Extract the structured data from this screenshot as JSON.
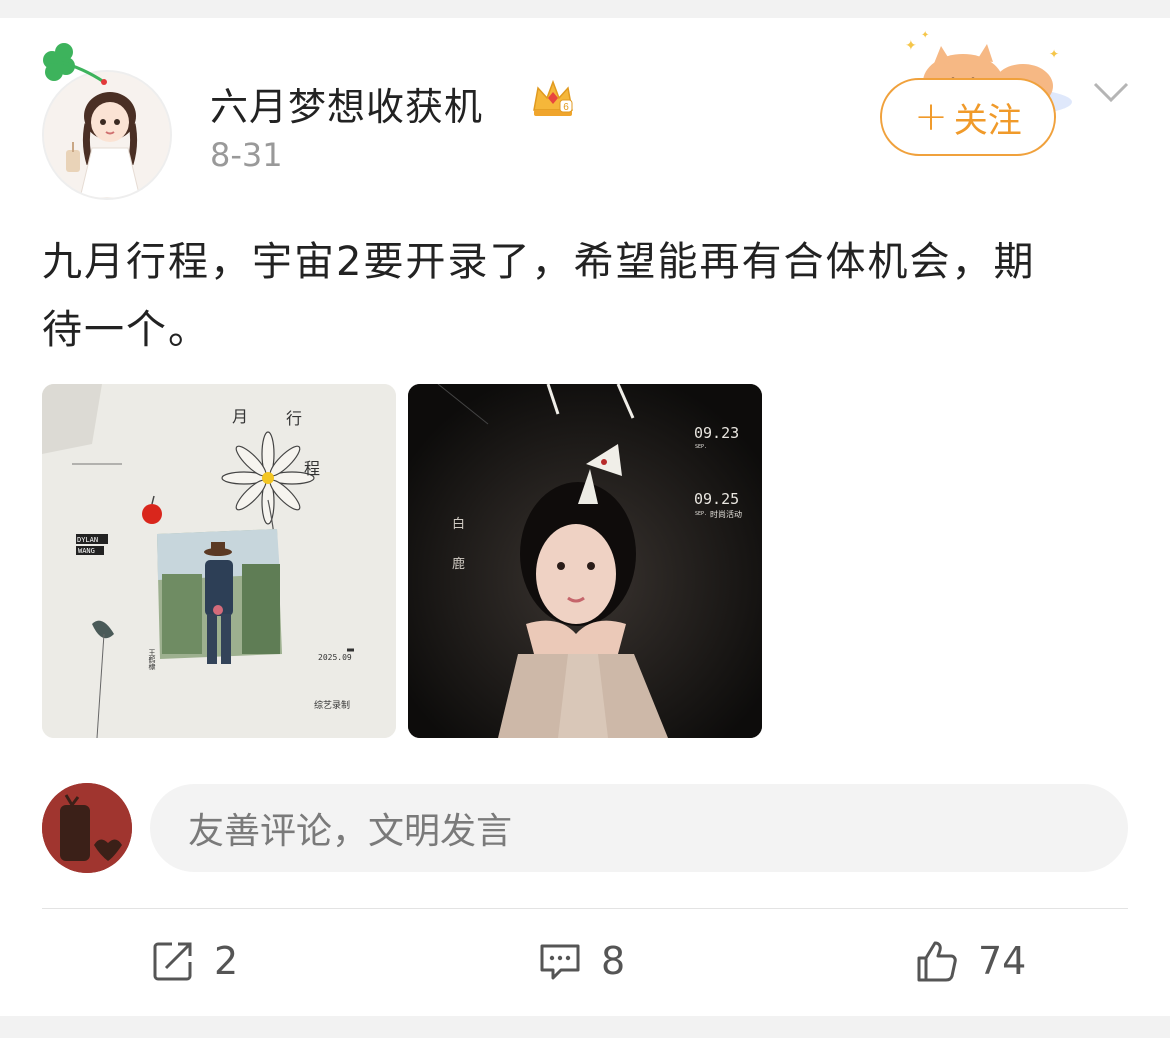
{
  "post": {
    "username": "六月梦想收获机",
    "date": "8-31",
    "follow_label": "关注",
    "text": "九月行程，宇宙2要开录了，希望能再有合体机会，期待一个。"
  },
  "images": [
    {
      "labels": {
        "title_1": "月",
        "title_2": "行",
        "title_3": "程",
        "brand_1": "DYLAN",
        "brand_2": "WANG",
        "name": "王鹤棣",
        "date": "2025.09",
        "caption": "综艺录制"
      }
    },
    {
      "labels": {
        "date_1": "09.23",
        "sep_1": "SEP.",
        "date_2": "09.25",
        "sep_2": "SEP.",
        "event": "时尚活动",
        "name_1": "白",
        "name_2": "鹿"
      }
    }
  ],
  "comment": {
    "placeholder": "友善评论，文明发言"
  },
  "actions": {
    "repost_count": "2",
    "comment_count": "8",
    "like_count": "74"
  },
  "colors": {
    "accent": "#f09a2a",
    "text": "#222222",
    "muted": "#999999"
  },
  "icons": {
    "repost": "share-icon",
    "comment": "comment-icon",
    "like": "thumbs-up-icon",
    "menu": "chevron-down-icon",
    "badge": "crown-icon"
  }
}
